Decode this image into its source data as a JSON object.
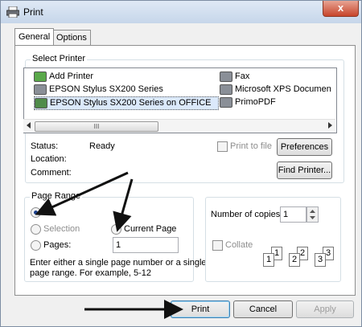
{
  "window": {
    "title": "Print",
    "close": "x"
  },
  "tabs": [
    {
      "label": "General"
    },
    {
      "label": "Options"
    }
  ],
  "select_printer": {
    "legend": "Select Printer",
    "printers_left": [
      "Add Printer",
      "EPSON Stylus SX200 Series",
      "EPSON Stylus SX200 Series on OFFICE"
    ],
    "printers_right": [
      "Fax",
      "Microsoft XPS Documen",
      "PrimoPDF"
    ],
    "scroll_grip": "III"
  },
  "status": {
    "status_label": "Status:",
    "status_value": "Ready",
    "location_label": "Location:",
    "comment_label": "Comment:",
    "print_to_file": "Print to file",
    "preferences": "Preferences",
    "find_printer": "Find Printer..."
  },
  "page_range": {
    "legend": "Page Range",
    "all": "All",
    "selection": "Selection",
    "current_page": "Current Page",
    "pages": "Pages:",
    "pages_value": "1",
    "hint_line1": "Enter either a single page number or a single",
    "hint_line2": "page range.  For example, 5-12"
  },
  "copies": {
    "label": "Number of copies:",
    "value": "1",
    "collate": "Collate",
    "page_nums": [
      "1",
      "1",
      "2",
      "2",
      "3",
      "3"
    ]
  },
  "footer": {
    "print": "Print",
    "cancel": "Cancel",
    "apply": "Apply"
  },
  "colors": {
    "title_gradient_top": "#dfe9f5",
    "close_red": "#c7452b",
    "selection_blue": "#dbe9fb"
  }
}
